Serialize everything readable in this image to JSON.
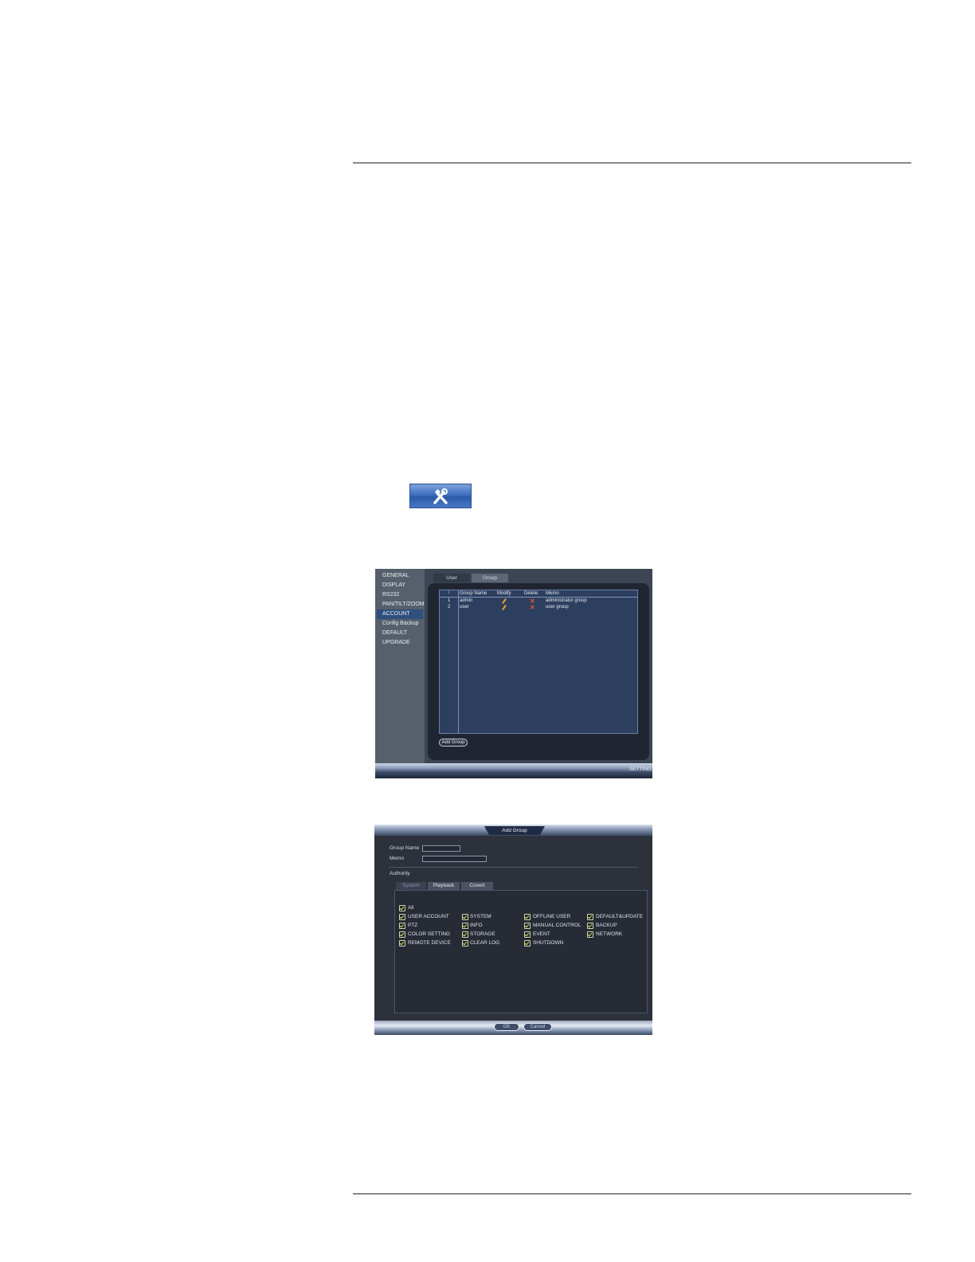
{
  "shot1": {
    "sidebar": [
      "GENERAL",
      "DISPLAY",
      "RS232",
      "PAN/TILT/ZOOM",
      "ACCOUNT",
      "Config Backup",
      "DEFAULT",
      "UPGRADE"
    ],
    "tabs": [
      "User",
      "Group"
    ],
    "active_tab": "Group",
    "columns": [
      "Group Name",
      "Modify",
      "Delete",
      "Memo"
    ],
    "rows": [
      {
        "num": "1",
        "name": "admin",
        "memo": "administrator group"
      },
      {
        "num": "2",
        "name": "user",
        "memo": "user group"
      }
    ],
    "add_group_label": "Add Group",
    "footer_label": "SETTING"
  },
  "shot2": {
    "title": "Add Group",
    "group_name_label": "Group Name",
    "memo_label": "Memo",
    "authority_label": "Authority",
    "tabs": [
      "System",
      "Playback",
      "Covert"
    ],
    "all_label": "All",
    "permissions": [
      [
        "USER ACCOUNT",
        "SYSTEM",
        "OFFLINE USER",
        "DEFAULT&UPDATE"
      ],
      [
        "PTZ",
        "INFO",
        "MANUAL CONTROL",
        "BACKUP"
      ],
      [
        "COLOR SETTING",
        "STORAGE",
        "EVENT",
        "NETWORK"
      ],
      [
        "REMOTE DEVICE",
        "CLEAR LOG",
        "SHUTDOWN",
        ""
      ]
    ],
    "ok_label": "OK",
    "cancel_label": "Cancel"
  },
  "icons": {
    "tool_button": "tools-icon",
    "modify": "pencil-icon",
    "delete": "close-icon",
    "check": "checkmark-icon"
  },
  "colors": {
    "accent_blue": "#3f6fbf",
    "panel_dark": "#1f2631",
    "check": "#d7e36a",
    "delete": "#e05a2a"
  }
}
